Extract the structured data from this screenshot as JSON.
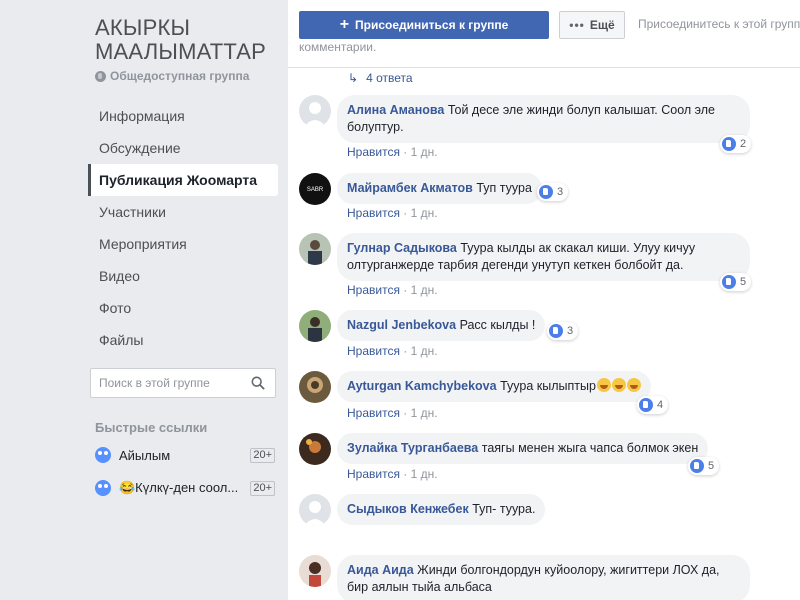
{
  "group": {
    "title_line1": "АКЫРКЫ",
    "title_line2": "МААЛЫМАТТАР",
    "type": "Общедоступная группа"
  },
  "nav": [
    {
      "label": "Информация"
    },
    {
      "label": "Обсуждение"
    },
    {
      "label": "Публикация Жоомарта",
      "active": true
    },
    {
      "label": "Участники"
    },
    {
      "label": "Мероприятия"
    },
    {
      "label": "Видео"
    },
    {
      "label": "Фото"
    },
    {
      "label": "Файлы"
    }
  ],
  "search": {
    "placeholder": "Поиск в этой группе"
  },
  "quick_links": {
    "title": "Быстрые ссылки",
    "items": [
      {
        "label": "Айылым",
        "badge": "20+"
      },
      {
        "label": "😂Күлкү-ден соол...",
        "badge": "20+"
      }
    ]
  },
  "header": {
    "join_label": "Присоединиться к группе",
    "more_label": "Ещё",
    "hint_line1": "Присоединитесь к этой групп",
    "hint_line2": "комментарии."
  },
  "replies_label": "4 ответа",
  "comments": [
    {
      "name": "Алина Аманова",
      "text": "Той десе эле жинди болуп калышат. Соол эле болуптур.",
      "like": "Нравится",
      "time": "1 дн.",
      "reactions": "2"
    },
    {
      "name": "Майрамбек Акматов",
      "text": "Туп туура",
      "like": "Нравится",
      "time": "1 дн.",
      "reactions": "3"
    },
    {
      "name": "Гулнар Садыкова",
      "text": "Туура кылды ак скакал киши. Улуу кичуу олтурганжерде тарбия дегенди унутуп кеткен болбойт да.",
      "like": "Нравится",
      "time": "1 дн.",
      "reactions": "5"
    },
    {
      "name": "Nazgul Jenbekova",
      "text": "Расс кылды !",
      "like": "Нравится",
      "time": "1 дн.",
      "reactions": "3"
    },
    {
      "name": "Ayturgan Kamchybekova",
      "text": "Туура кылыптыр",
      "like": "Нравится",
      "time": "1 дн.",
      "reactions": "4"
    },
    {
      "name": "Зулайка Турганбаева",
      "text": "таягы менен жыга чапса болмок экен",
      "like": "Нравится",
      "time": "1 дн.",
      "reactions": "5"
    },
    {
      "name": "Сыдыков Кенжебек",
      "text": "Туп- туура.",
      "like": "Нравится",
      "time": "1 дн.",
      "reactions": ""
    },
    {
      "name": "Аида Аида",
      "text": "Жинди болгондордун куйоолору, жигиттери ЛОХ да, бир аялын тыйа альбаса",
      "like": "",
      "time": "",
      "reactions": ""
    }
  ],
  "colors": {
    "brand": "#4267b2",
    "link": "#385898",
    "bg": "#e9ebee"
  }
}
